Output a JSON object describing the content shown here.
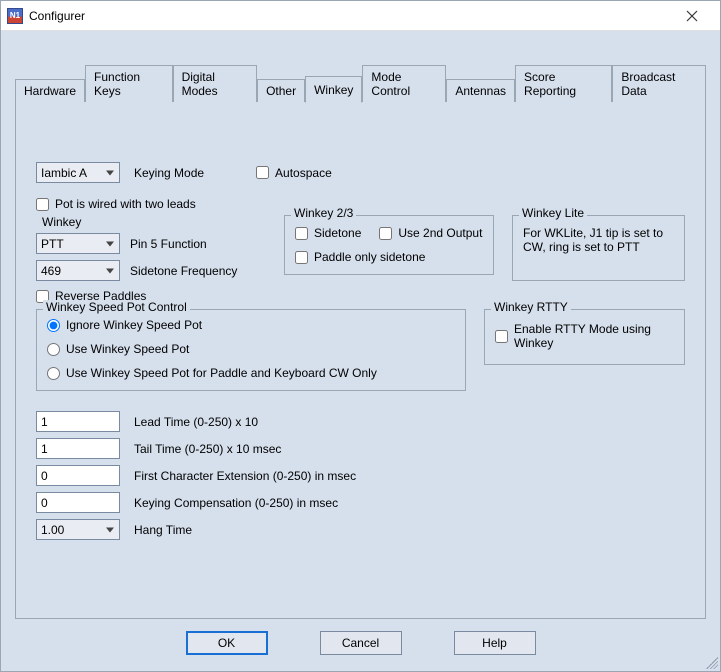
{
  "window": {
    "title": "Configurer",
    "app_icon_text": "N1"
  },
  "tabs": [
    {
      "label": "Hardware"
    },
    {
      "label": "Function Keys"
    },
    {
      "label": "Digital Modes"
    },
    {
      "label": "Other"
    },
    {
      "label": "Winkey",
      "active": true
    },
    {
      "label": "Mode Control"
    },
    {
      "label": "Antennas"
    },
    {
      "label": "Score Reporting"
    },
    {
      "label": "Broadcast Data"
    }
  ],
  "form": {
    "keying_mode": {
      "value": "Iambic A",
      "label": "Keying Mode"
    },
    "autospace": {
      "label": "Autospace"
    },
    "pot_two_leads": {
      "label": "Pot is wired with two leads"
    },
    "winkey_group": {
      "title": "Winkey",
      "pin5": {
        "value": "PTT",
        "label": "Pin 5 Function"
      },
      "sidetone_freq": {
        "value": "469",
        "label": "Sidetone Frequency"
      }
    },
    "reverse_paddles": {
      "label": "Reverse Paddles"
    },
    "speed_pot_group": {
      "title": "Winkey Speed Pot Control",
      "opt_ignore": "Ignore Winkey Speed Pot",
      "opt_use": "Use Winkey Speed Pot",
      "opt_use_paddle": "Use Winkey Speed Pot for Paddle and Keyboard CW Only"
    },
    "winkey23_group": {
      "title": "Winkey 2/3",
      "sidetone": "Sidetone",
      "use2nd": "Use 2nd Output",
      "paddle_only": "Paddle only sidetone"
    },
    "winkey_lite_group": {
      "title": "Winkey Lite",
      "text": "For WKLite, J1 tip is set to CW, ring is set to PTT"
    },
    "winkey_rtty_group": {
      "title": "Winkey RTTY",
      "enable": "Enable RTTY Mode using Winkey"
    },
    "lead_time": {
      "value": "1",
      "label": "Lead Time (0-250) x 10"
    },
    "tail_time": {
      "value": "1",
      "label": "Tail Time (0-250) x 10 msec"
    },
    "first_char_ext": {
      "value": "0",
      "label": "First Character Extension (0-250) in msec"
    },
    "keying_comp": {
      "value": "0",
      "label": "Keying Compensation (0-250) in msec"
    },
    "hang_time": {
      "value": "1.00",
      "label": "Hang Time"
    }
  },
  "buttons": {
    "ok": "OK",
    "cancel": "Cancel",
    "help": "Help"
  }
}
